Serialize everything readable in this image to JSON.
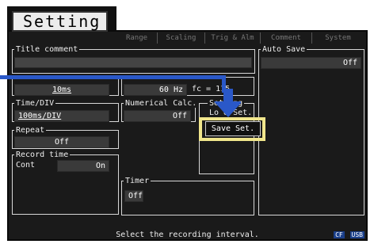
{
  "header": {
    "title": "Setting"
  },
  "tabs": [
    {
      "label": "Range"
    },
    {
      "label": "Scaling"
    },
    {
      "label": "Trig & Alm"
    },
    {
      "label": "Comment"
    },
    {
      "label": "System"
    }
  ],
  "title_comment": {
    "label": "Title comment",
    "value": ""
  },
  "auto_save": {
    "label": "Auto Save",
    "value": "Off"
  },
  "sampling": {
    "value": "10ms"
  },
  "filter": {
    "freq": "60 Hz",
    "fc_prefix": "fc = 115"
  },
  "time_div": {
    "label": "Time/DIV",
    "value": "100ms/DIV"
  },
  "numerical_calc": {
    "label": "Numerical Calc.",
    "value": "Off"
  },
  "settings_group": {
    "label_top": "Set ing",
    "label_bottom": "Lo d Set."
  },
  "repeat": {
    "label": "Repeat",
    "value": "Off"
  },
  "record_time": {
    "label": "Record time",
    "mode": "Cont",
    "value": "On"
  },
  "timer": {
    "label": "Timer",
    "value": "Off"
  },
  "callout": {
    "label": "Save Set."
  },
  "status": {
    "text": "Select the recording interval."
  },
  "status_icons": {
    "cf": "CF",
    "usb": "USB"
  },
  "colors": {
    "highlight": "#f0e68c",
    "pointer": "#2a58c8"
  }
}
